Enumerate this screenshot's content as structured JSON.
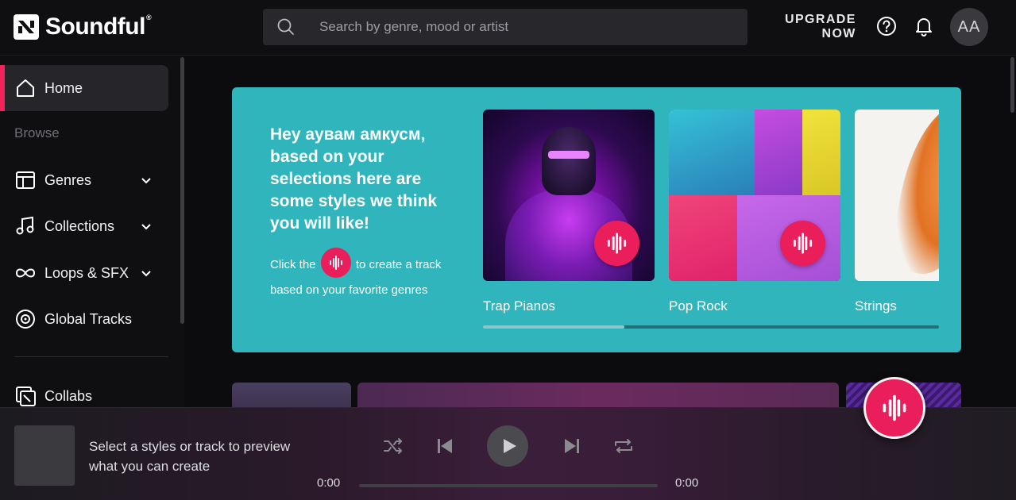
{
  "header": {
    "brand": "Soundful",
    "brand_mark": "®",
    "search_placeholder": "Search by genre, mood or artist",
    "upgrade_line1": "UPGRADE",
    "upgrade_line2": "NOW",
    "avatar_initials": "AA",
    "icons": [
      "help-icon",
      "bell-icon",
      "search-icon"
    ]
  },
  "sidebar": {
    "browse_label": "Browse",
    "items": [
      {
        "label": "Home",
        "icon": "home-icon",
        "active": true
      },
      {
        "label": "Genres",
        "icon": "genres-icon"
      },
      {
        "label": "Collections",
        "icon": "music-note-icon"
      },
      {
        "label": "Loops & SFX",
        "icon": "infinity-icon"
      },
      {
        "label": "Global Tracks",
        "icon": "disc-icon"
      },
      {
        "label": "Collabs",
        "icon": "collabs-icon"
      }
    ]
  },
  "banner": {
    "heading": "Hey аувам амкусм, based on your selections here are some styles we think you will like!",
    "sub_before": "Click the",
    "sub_after": "to create a track based on your favorite genres",
    "cards": [
      {
        "label": "Trap Pianos"
      },
      {
        "label": "Pop Rock"
      },
      {
        "label": "Strings"
      }
    ],
    "scroll_progress": 0.31
  },
  "player": {
    "message": "Select a styles or track to preview what you can create",
    "time_current": "0:00",
    "time_total": "0:00",
    "progress": 0
  },
  "colors": {
    "accent": "#e91e5a",
    "banner": "#2fb5bb"
  }
}
